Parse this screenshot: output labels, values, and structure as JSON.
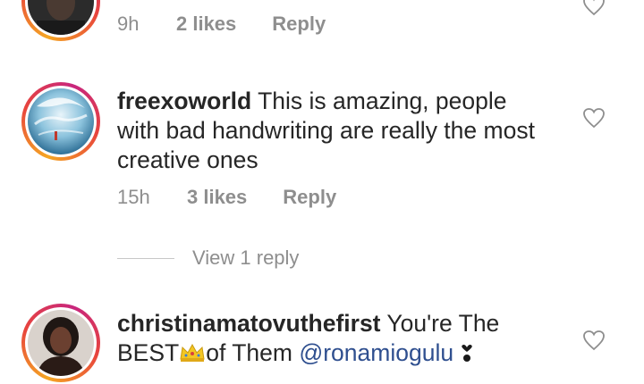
{
  "comments": [
    {
      "username": "",
      "text": "",
      "time": "9h",
      "likes": "2 likes",
      "reply_label": "Reply",
      "avatar_icon": "user-photo-avatar"
    },
    {
      "username": "freexoworld",
      "text_lines": [
        "This is amazing, people",
        "with bad handwriting are really the most",
        "creative ones"
      ],
      "time": "15h",
      "likes": "3 likes",
      "reply_label": "Reply",
      "avatar_icon": "illustration-avatar",
      "view_replies": "View 1 reply"
    },
    {
      "username": "christinamatovuthefirst",
      "text_part1": "You're The",
      "text_part2": "BEST",
      "crown_emoji": "👑",
      "text_part3": "of Them",
      "mention": "@ronamiogulu",
      "bow_emoji": "❣",
      "avatar_icon": "user-photo-avatar"
    }
  ],
  "colors": {
    "text": "#262626",
    "meta": "#8e8e8e",
    "mention": "#2f4f8f",
    "ring_start": "#f5a623",
    "ring_mid": "#c8267d"
  }
}
